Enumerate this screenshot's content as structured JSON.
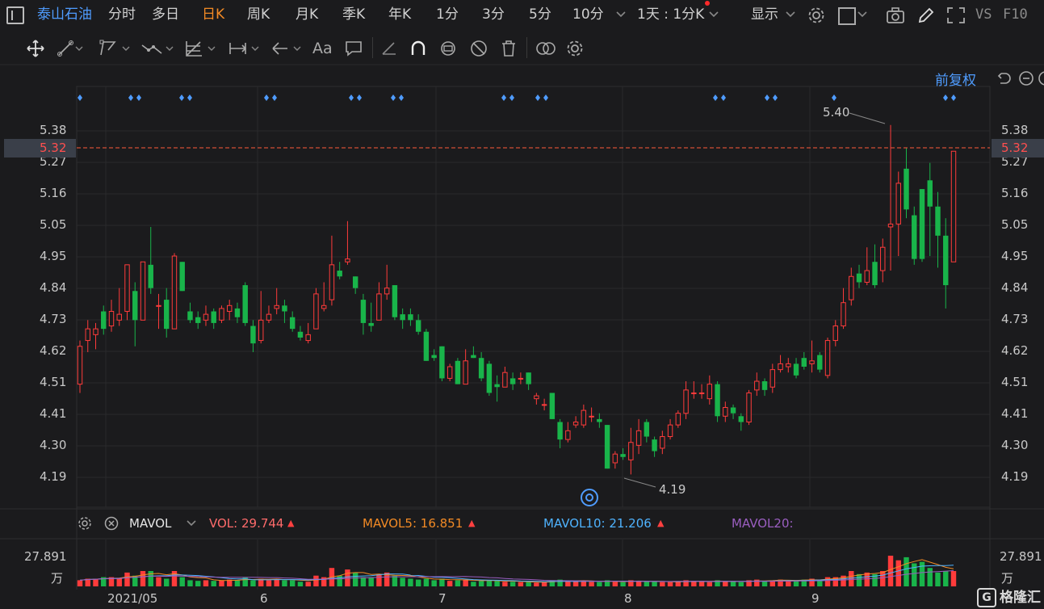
{
  "topbar": {
    "stock_name": "泰山石油",
    "periods": [
      "分时",
      "多日",
      "日K",
      "周K",
      "月K",
      "季K",
      "年K",
      "1分",
      "3分",
      "5分",
      "10分"
    ],
    "active_period": "日K",
    "interval_select": "1天 : 1分K",
    "display_label": "显示",
    "vs_label": "VS",
    "f10_label": "F10"
  },
  "toolbar": {
    "font_tool": "Aa"
  },
  "main_chart": {
    "adjust_label": "前复权",
    "y_ticks": [
      "5.38",
      "5.27",
      "5.16",
      "5.05",
      "4.95",
      "4.84",
      "4.73",
      "4.62",
      "4.51",
      "4.41",
      "4.30",
      "4.19"
    ],
    "current_price": "5.32",
    "high_label": "5.40",
    "low_label": "4.19",
    "colors": {
      "up": "#ff3b3b",
      "down": "#19b44a",
      "marker": "#4f9cff",
      "current_line": "#ff5a3c"
    }
  },
  "indicator": {
    "name": "MAVOL",
    "vol_label": "VOL: 29.744",
    "mavol5_label": "MAVOL5: 16.851",
    "mavol10_label": "MAVOL10: 21.206",
    "mavol20_label": "MAVOL20:",
    "up_arrow": "▲",
    "vol_color": "#ff6b6b",
    "mavol5_color": "#f28a25",
    "mavol10_color": "#4fb3ff",
    "mavol20_color": "#9a5ec0"
  },
  "volume_chart": {
    "y_max_label": "27.891",
    "unit_label": "万"
  },
  "x_axis": {
    "labels": [
      "2021/05",
      "6",
      "7",
      "8",
      "9"
    ]
  },
  "logo": {
    "text": "格隆汇",
    "mark": "G"
  }
}
